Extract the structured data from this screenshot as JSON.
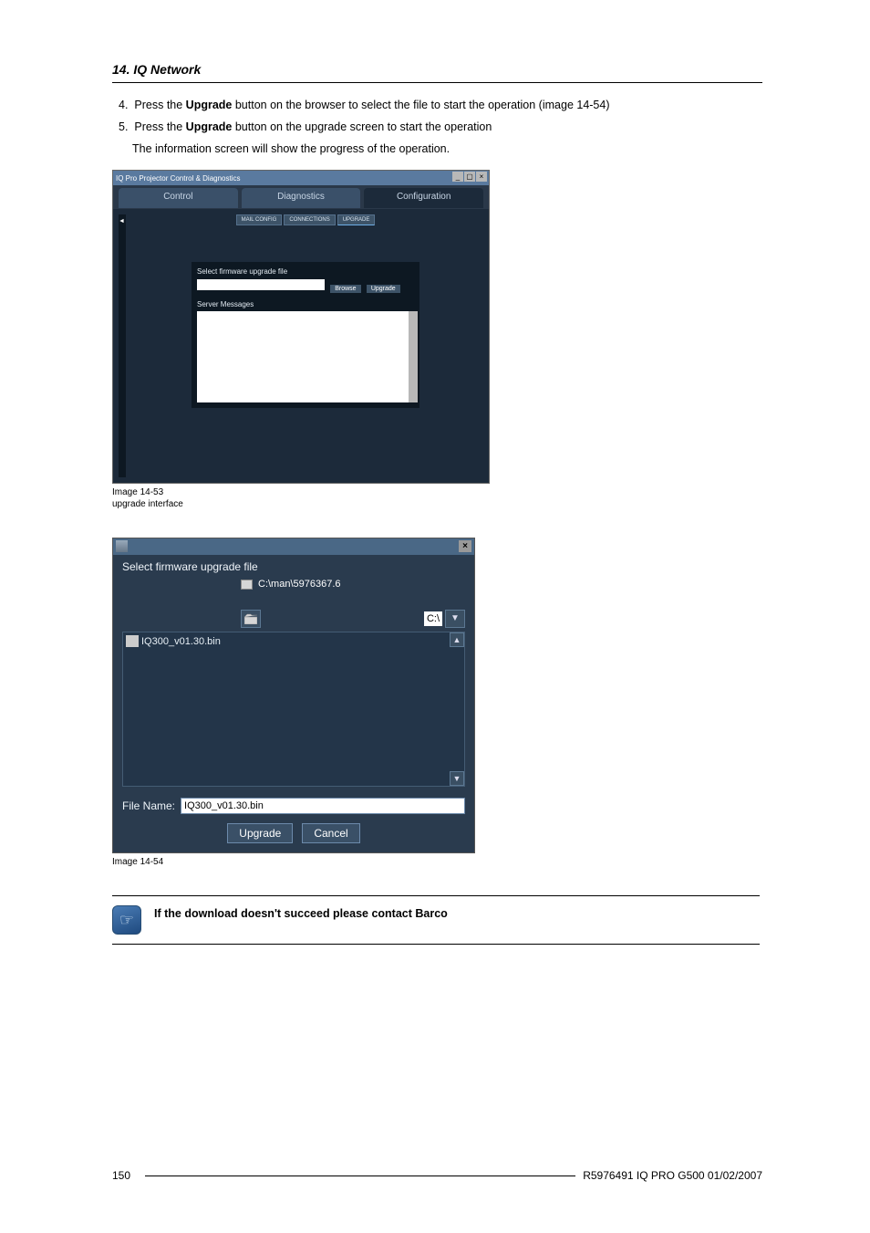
{
  "header": {
    "section": "14. IQ Network"
  },
  "steps": {
    "s4": {
      "num": "4.",
      "text_a": "Press the ",
      "bold": "Upgrade",
      "text_b": " button on the browser to select the file to start the operation (image 14-54)"
    },
    "s5": {
      "num": "5.",
      "text_a": "Press the ",
      "bold": "Upgrade",
      "text_b": " button on the upgrade screen to start the operation"
    },
    "s5_sub": "The information screen will show the progress of the operation."
  },
  "shot1": {
    "titlebar": "IQ Pro Projector Control & Diagnostics",
    "tabs": {
      "control": "Control",
      "diagnostics": "Diagnostics",
      "configuration": "Configuration"
    },
    "btn_mail": "MAIL\nCONFIG",
    "btn_conn": "CONNECTIONS",
    "btn_upgrade": "UPGRADE",
    "label_select": "Select firmware upgrade file",
    "label_msg": "Server Messages",
    "act_browse": "Browse",
    "act_upgrade": "Upgrade"
  },
  "caption1": {
    "line1": "Image 14-53",
    "line2": "upgrade interface"
  },
  "shot2": {
    "heading": "Select firmware upgrade file",
    "path": "C:\\man\\5976367.6",
    "drive": "C:\\",
    "file_item": "IQ300_v01.30.bin",
    "filename_label": "File Name:",
    "filename_value": "IQ300_v01.30.bin",
    "btn_upgrade": "Upgrade",
    "btn_cancel": "Cancel"
  },
  "caption2": "Image 14-54",
  "note": "If the download doesn't succeed please contact Barco",
  "footer": {
    "page": "150",
    "doc": "R5976491  IQ PRO G500  01/02/2007"
  }
}
